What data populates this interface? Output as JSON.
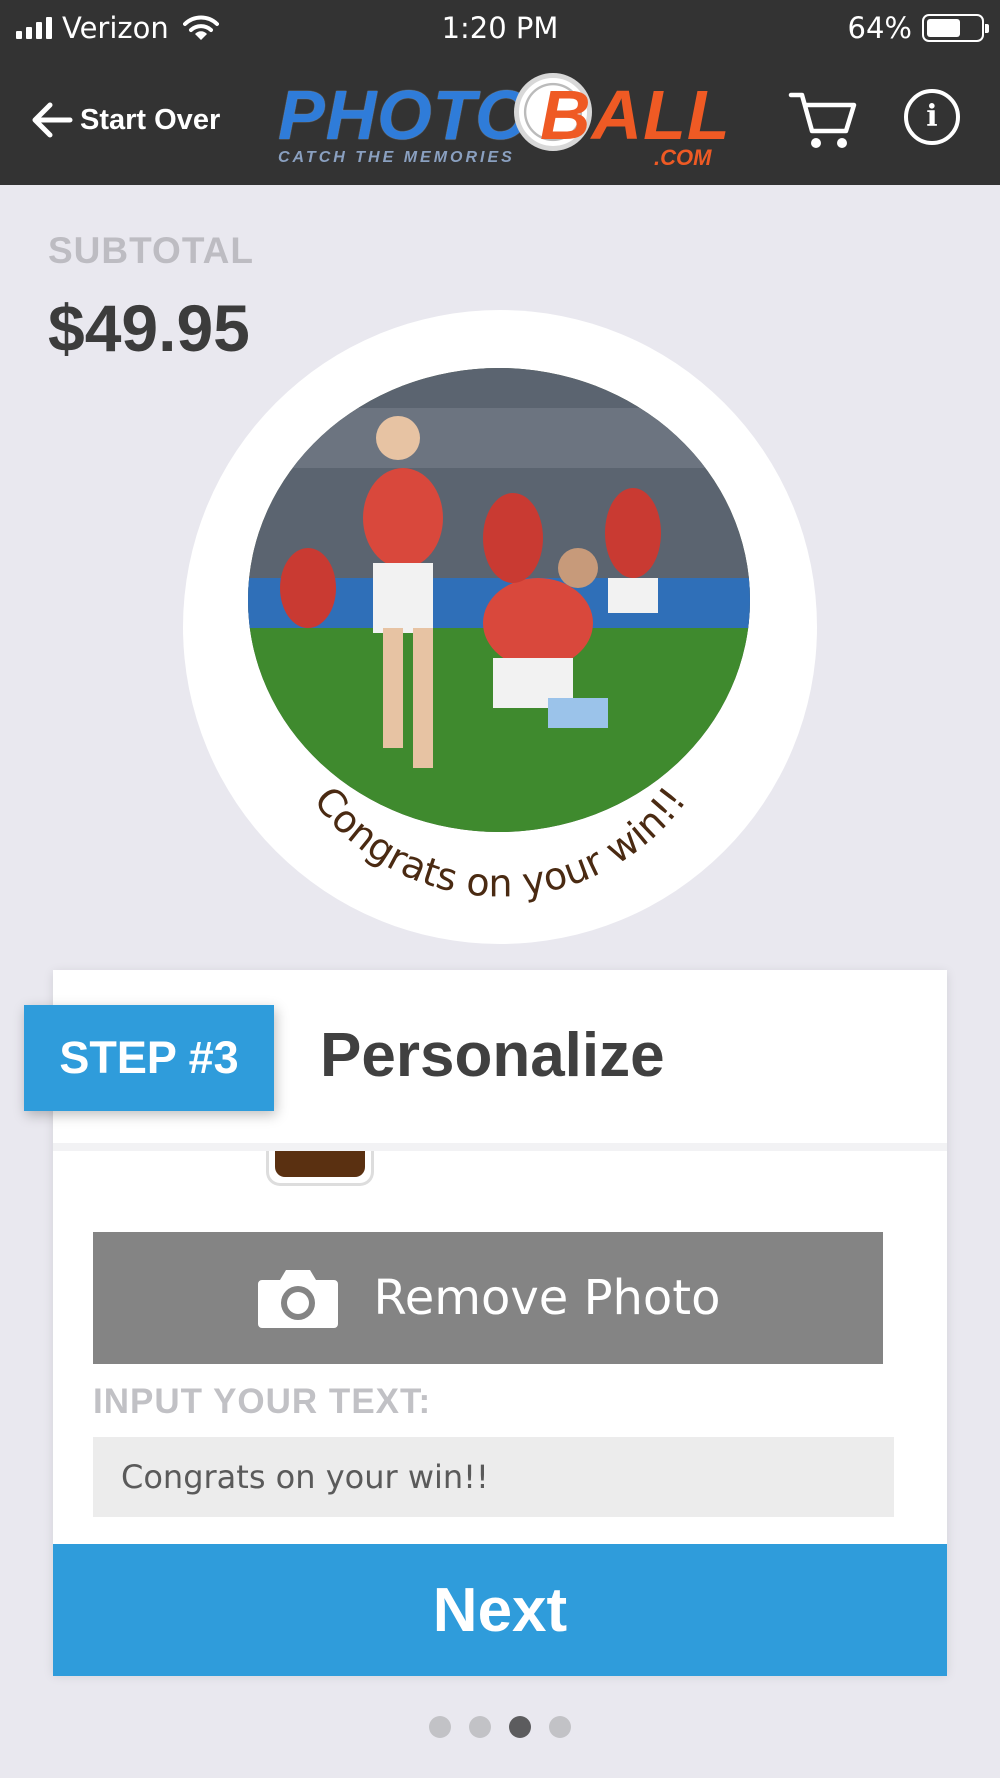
{
  "status_bar": {
    "carrier": "Verizon",
    "time": "1:20 PM",
    "battery_percent": "64%",
    "battery_level": 0.64,
    "signal_icon": "signal-bars-icon",
    "wifi_icon": "wifi-icon",
    "battery_icon": "battery-icon"
  },
  "header": {
    "back_label": "Start Over",
    "back_icon": "arrow-left-icon",
    "logo": {
      "word1": "PHOTO",
      "word2": "BALL",
      "tagline": "CATCH THE MEMORIES",
      "domain": ".COM"
    },
    "cart_icon": "cart-icon",
    "info_icon": "info-icon"
  },
  "subtotal": {
    "label": "SUBTOTAL",
    "value": "$49.95"
  },
  "preview": {
    "curved_text": "Congrats on your win!!",
    "text_color": "#4a2a12"
  },
  "step": {
    "badge": "STEP #3",
    "title": "Personalize",
    "selected_color": "#5a3011"
  },
  "actions": {
    "remove_photo_label": "Remove Photo",
    "camera_icon": "camera-icon",
    "input_label": "INPUT YOUR TEXT:",
    "input_value": "Congrats on your win!!",
    "next_label": "Next"
  },
  "pager": {
    "total": 4,
    "current": 3
  },
  "colors": {
    "header_bg": "#333333",
    "accent_blue": "#2f9cdb",
    "logo_blue": "#2f7cd9",
    "logo_orange": "#ef5a24",
    "page_bg": "#e9e8ef",
    "remove_btn_bg": "#848484"
  }
}
